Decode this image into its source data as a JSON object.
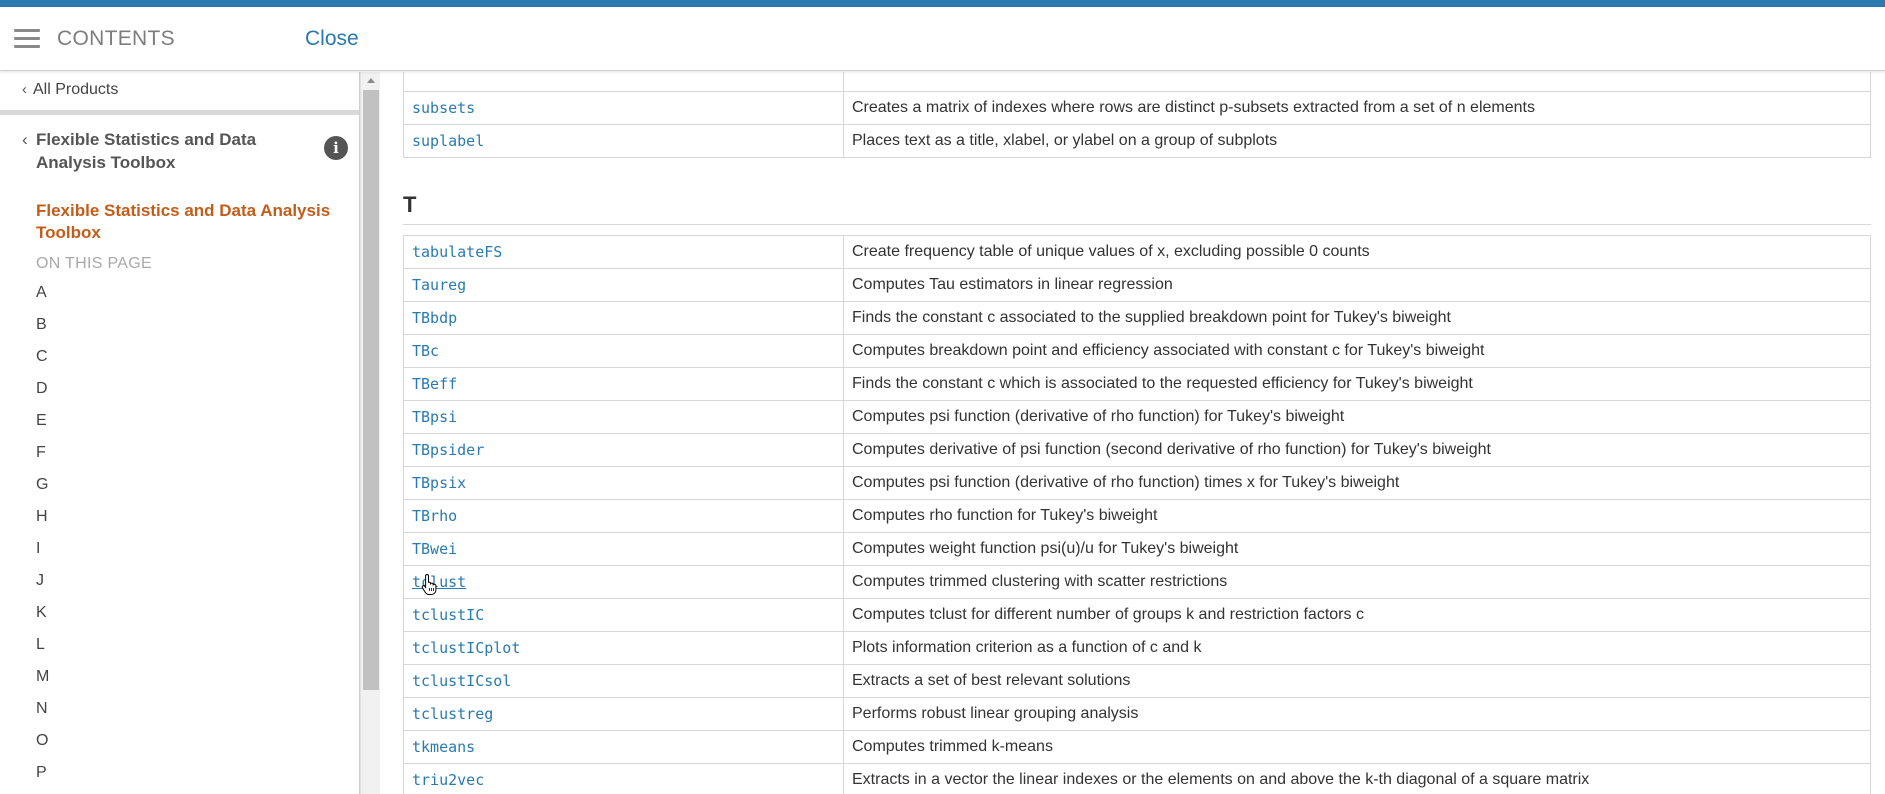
{
  "header": {
    "title": "CONTENTS",
    "close_label": "Close"
  },
  "sidebar": {
    "all_products": "All Products",
    "toolbox_heading": "Flexible Statistics and Data Analysis Toolbox",
    "current_page": "Flexible Statistics and Data Analysis Toolbox",
    "on_this_page": "ON THIS PAGE",
    "letters": [
      "A",
      "B",
      "C",
      "D",
      "E",
      "F",
      "G",
      "H",
      "I",
      "J",
      "K",
      "L",
      "M",
      "N",
      "O",
      "P"
    ]
  },
  "main": {
    "top_rows": [
      {
        "fn": "subsets",
        "desc": "Creates a matrix of indexes where rows are distinct p-subsets extracted from a set of n elements"
      },
      {
        "fn": "suplabel",
        "desc": "Places text as a title, xlabel, or ylabel on a group of subplots"
      }
    ],
    "section_T": {
      "heading": "T",
      "rows": [
        {
          "fn": "tabulateFS",
          "desc": "Create frequency table of unique values of x, excluding possible 0 counts"
        },
        {
          "fn": "Taureg",
          "desc": "Computes Tau estimators in linear regression"
        },
        {
          "fn": "TBbdp",
          "desc": "Finds the constant c associated to the supplied breakdown point for Tukey's biweight"
        },
        {
          "fn": "TBc",
          "desc": "Computes breakdown point and efficiency associated with constant c for Tukey's biweight"
        },
        {
          "fn": "TBeff",
          "desc": "Finds the constant c which is associated to the requested efficiency for Tukey's biweight"
        },
        {
          "fn": "TBpsi",
          "desc": "Computes psi function (derivative of rho function) for Tukey's biweight"
        },
        {
          "fn": "TBpsider",
          "desc": "Computes derivative of psi function (second derivative of rho function) for Tukey's biweight"
        },
        {
          "fn": "TBpsix",
          "desc": "Computes psi function (derivative of rho function) times x for Tukey's biweight"
        },
        {
          "fn": "TBrho",
          "desc": "Computes rho function for Tukey's biweight"
        },
        {
          "fn": "TBwei",
          "desc": "Computes weight function psi(u)/u for Tukey's biweight"
        },
        {
          "fn": "tclust",
          "desc": "Computes trimmed clustering with scatter restrictions"
        },
        {
          "fn": "tclustIC",
          "desc": "Computes tclust for different number of groups k and restriction factors c"
        },
        {
          "fn": "tclustICplot",
          "desc": "Plots information criterion as a function of c and k"
        },
        {
          "fn": "tclustICsol",
          "desc": "Extracts a set of best relevant solutions"
        },
        {
          "fn": "tclustreg",
          "desc": "Performs robust linear grouping analysis"
        },
        {
          "fn": "tkmeans",
          "desc": "Computes trimmed k-means"
        },
        {
          "fn": "triu2vec",
          "desc": "Extracts in a vector the linear indexes or the elements on and above the k-th diagonal of a square matrix"
        }
      ]
    }
  },
  "colors": {
    "accent": "#2a7ab0",
    "current_page": "#c45c1a"
  }
}
